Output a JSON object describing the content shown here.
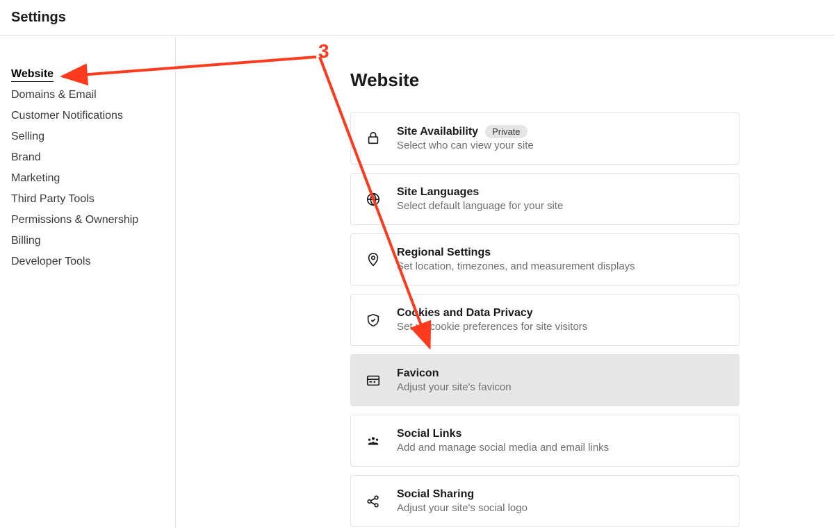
{
  "header": {
    "title": "Settings"
  },
  "sidebar": {
    "items": [
      {
        "label": "Website",
        "active": true
      },
      {
        "label": "Domains & Email"
      },
      {
        "label": "Customer Notifications"
      },
      {
        "label": "Selling"
      },
      {
        "label": "Brand"
      },
      {
        "label": "Marketing"
      },
      {
        "label": "Third Party Tools"
      },
      {
        "label": "Permissions & Ownership"
      },
      {
        "label": "Billing"
      },
      {
        "label": "Developer Tools"
      }
    ]
  },
  "main": {
    "title": "Website",
    "cards": [
      {
        "icon": "lock-icon",
        "title": "Site Availability",
        "badge": "Private",
        "desc": "Select who can view your site"
      },
      {
        "icon": "globe-icon",
        "title": "Site Languages",
        "desc": "Select default language for your site"
      },
      {
        "icon": "pin-icon",
        "title": "Regional Settings",
        "desc": "Set location, timezones, and measurement displays"
      },
      {
        "icon": "shield-check-icon",
        "title": "Cookies and Data Privacy",
        "desc": "Set up cookie preferences for site visitors"
      },
      {
        "icon": "favicon-icon",
        "title": "Favicon",
        "desc": "Adjust your site's favicon",
        "hover": true
      },
      {
        "icon": "people-icon",
        "title": "Social Links",
        "desc": "Add and manage social media and email links"
      },
      {
        "icon": "share-icon",
        "title": "Social Sharing",
        "desc": "Adjust your site's social logo"
      }
    ]
  },
  "annotation": {
    "step": "3",
    "color": "#ff3b1f"
  }
}
